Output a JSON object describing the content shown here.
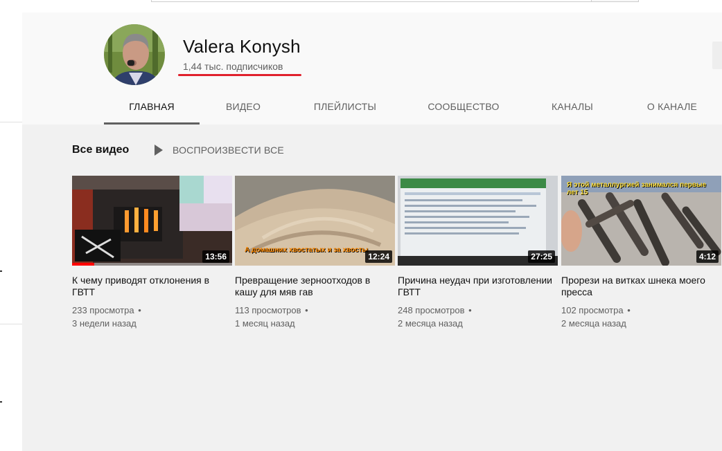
{
  "channel": {
    "name": "Valera Konysh",
    "subscribers": "1,44 тыс. подписчиков"
  },
  "tabs": [
    {
      "label": "ГЛАВНАЯ",
      "active": true
    },
    {
      "label": "ВИДЕО",
      "active": false
    },
    {
      "label": "ПЛЕЙЛИСТЫ",
      "active": false
    },
    {
      "label": "СООБЩЕСТВО",
      "active": false
    },
    {
      "label": "КАНАЛЫ",
      "active": false
    },
    {
      "label": "О КАНАЛЕ",
      "active": false
    }
  ],
  "section": {
    "title": "Все видео",
    "play_all_label": "ВОСПРОИЗВЕСТИ ВСЕ"
  },
  "videos": [
    {
      "title": "К чему приводят отклонения в ГВТТ",
      "views": "233 просмотра",
      "age": "3 недели назад",
      "duration": "13:56",
      "watched_progress": 0.14
    },
    {
      "title": "Превращение зерноотходов в кашу для мяв гав",
      "views": "113 просмотров",
      "age": "1 месяц назад",
      "duration": "12:24",
      "thumb_caption": "А домашних хвостатых и за хвосты"
    },
    {
      "title": "Причина неудач при изготовлении ГВТТ",
      "views": "248 просмотров",
      "age": "2 месяца назад",
      "duration": "27:25"
    },
    {
      "title": "Прорези на витках шнека моего пресса",
      "views": "102 просмотра",
      "age": "2 месяца назад",
      "duration": "4:12",
      "thumb_caption": "Я этой металлургией занимался первые лет 15"
    }
  ],
  "colors": {
    "accent_underline": "#e0202c",
    "progress": "#ff0000"
  }
}
